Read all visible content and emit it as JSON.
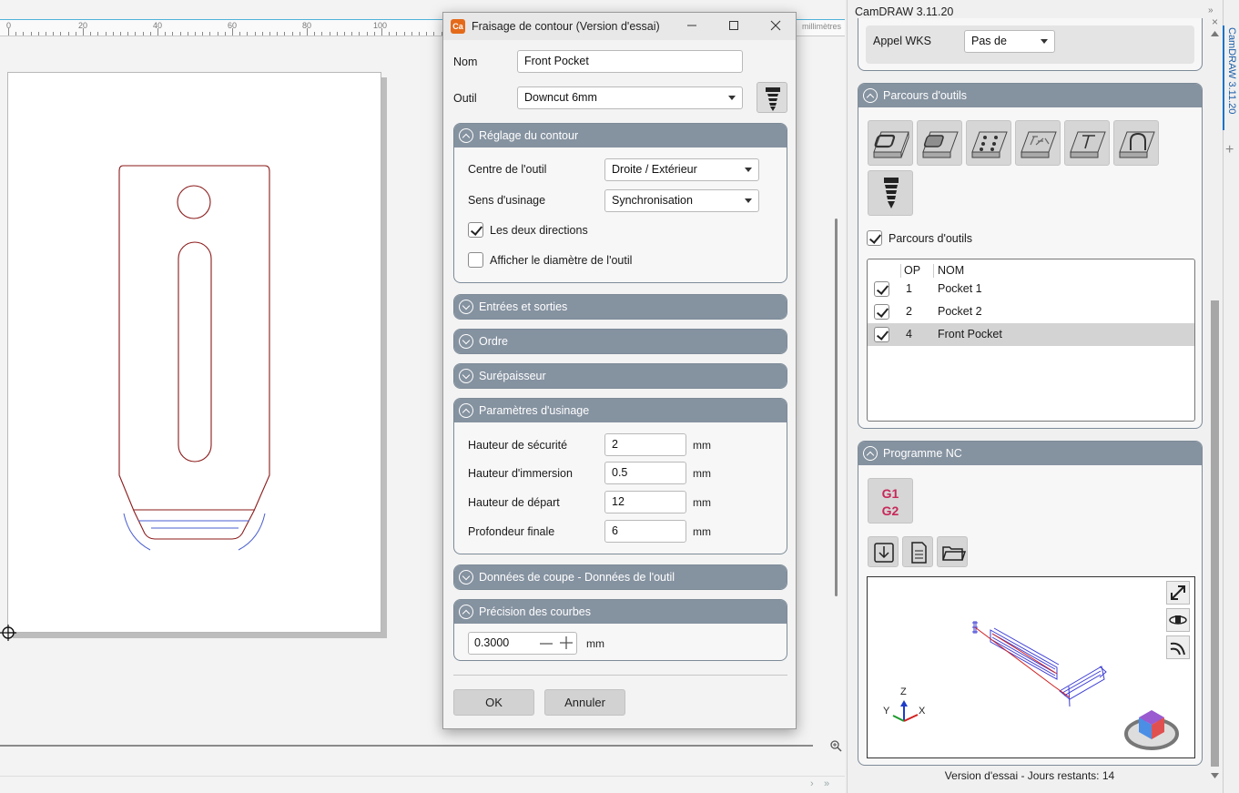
{
  "canvas": {
    "ruler_labels": [
      "0",
      "20",
      "40",
      "60",
      "80",
      "100"
    ],
    "ruler_unit": "millimètres"
  },
  "dialog": {
    "title": "Fraisage de contour (Version d'essai)",
    "logo_text": "Ca",
    "name_label": "Nom",
    "name_value": "Front Pocket",
    "tool_label": "Outil",
    "tool_value": "Downcut 6mm",
    "panels": {
      "contour": "Réglage du contour",
      "entries": "Entrées et sorties",
      "order": "Ordre",
      "overthickness": "Surépaisseur",
      "machining": "Paramètres d'usinage",
      "cutting_data": "Données de coupe - Données de l'outil",
      "curve_precision": "Précision des courbes"
    },
    "contour": {
      "tool_center_label": "Centre de l'outil",
      "tool_center_value": "Droite / Extérieur",
      "direction_label": "Sens d'usinage",
      "direction_value": "Synchronisation",
      "both_directions_label": "Les deux directions",
      "both_directions_checked": true,
      "show_diameter_label": "Afficher le diamètre de l'outil",
      "show_diameter_checked": false
    },
    "machining": {
      "safety_height_label": "Hauteur de sécurité",
      "safety_height_value": "2",
      "plunge_height_label": "Hauteur d'immersion",
      "plunge_height_value": "0.5",
      "start_height_label": "Hauteur de départ",
      "start_height_value": "12",
      "final_depth_label": "Profondeur finale",
      "final_depth_value": "6",
      "unit": "mm"
    },
    "precision": {
      "value": "0.3000",
      "unit": "mm"
    },
    "ok_label": "OK",
    "cancel_label": "Annuler"
  },
  "right_panel": {
    "title": "CamDRAW 3.11.20",
    "wks_label": "Appel WKS",
    "wks_value": "Pas de",
    "toolpaths_header": "Parcours d'outils",
    "toolpaths_checkbox_label": "Parcours d'outils",
    "toolpath_icons": [
      "contour-toolpath-icon",
      "pocket-toolpath-icon",
      "drill-toolpath-icon",
      "text-toolpath-icon",
      "engrave-toolpath-icon",
      "slot-toolpath-icon",
      "tool-icon"
    ],
    "table": {
      "col_op": "OP",
      "col_name": "NOM",
      "rows": [
        {
          "op": "1",
          "name": "Pocket 1",
          "checked": true,
          "selected": false
        },
        {
          "op": "2",
          "name": "Pocket 2",
          "checked": true,
          "selected": false
        },
        {
          "op": "4",
          "name": "Front Pocket",
          "checked": true,
          "selected": true
        }
      ]
    },
    "nc_header": "Programme NC",
    "nc_g1": "G1",
    "nc_g2": "G2",
    "axes": {
      "z": "Z",
      "y": "Y",
      "x": "X"
    },
    "footer": "Version d'essai - Jours restants: 14",
    "side_tab": "CamDRAW 3.11.20"
  },
  "colors": {
    "panel_header": "#8592a0",
    "drawing_contour": "#8b1a1a",
    "toolpath_preview": "#4a5fd0",
    "gcode_text": "#c8285a"
  }
}
